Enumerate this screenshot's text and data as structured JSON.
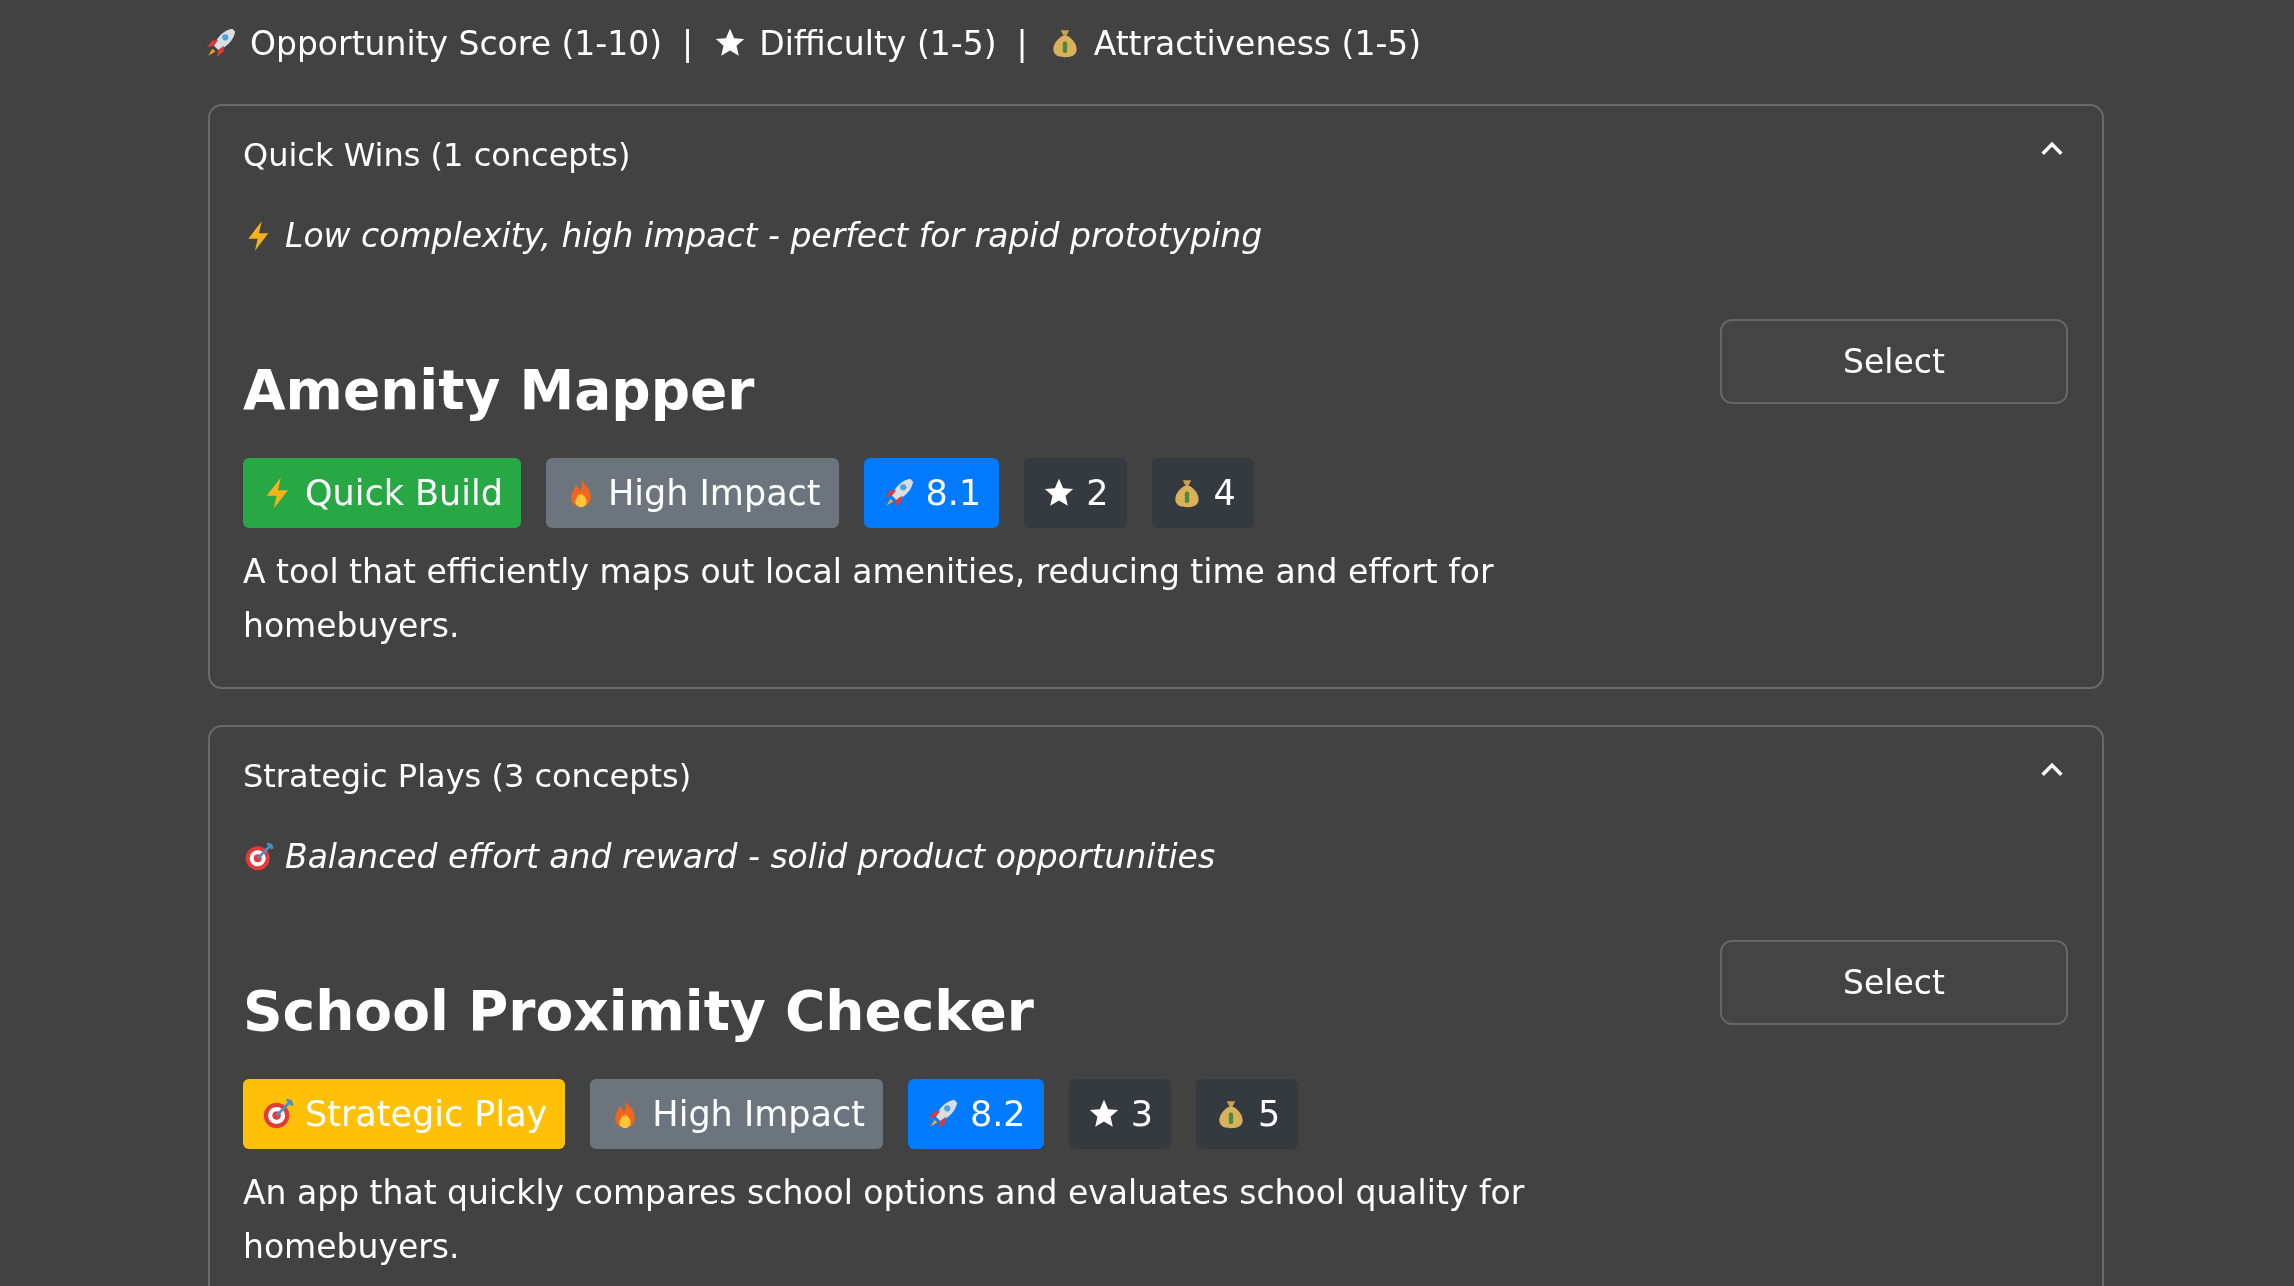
{
  "legend": [
    {
      "kind": "score",
      "label": "Opportunity Score (1-10)"
    },
    {
      "kind": "difficulty",
      "label": "Difficulty (1-5)"
    },
    {
      "kind": "attractiveness",
      "label": "Attractiveness (1-5)"
    }
  ],
  "legend_separator": "|",
  "sections": [
    {
      "title": "Quick Wins (1 concepts)",
      "expanded": true,
      "tagline": {
        "kind": "quick",
        "text": "Low complexity, high impact - perfect for rapid prototyping"
      },
      "concepts": [
        {
          "name": "Amenity Mapper",
          "button": "Select",
          "badges": [
            {
              "kind": "quick",
              "label": "Quick Build",
              "color": "#28a745"
            },
            {
              "kind": "impact",
              "label": "High Impact",
              "color": "#6c757d"
            },
            {
              "kind": "score",
              "label": "8.1",
              "color": "#007bff"
            },
            {
              "kind": "difficulty",
              "label": "2",
              "color": "#343a40"
            },
            {
              "kind": "attractiveness",
              "label": "4",
              "color": "#343a40"
            }
          ],
          "description": "A tool that efficiently maps out local amenities, reducing time and effort for homebuyers."
        }
      ]
    },
    {
      "title": "Strategic Plays (3 concepts)",
      "expanded": true,
      "tagline": {
        "kind": "strategic",
        "text": "Balanced effort and reward - solid product opportunities"
      },
      "concepts": [
        {
          "name": "School Proximity Checker",
          "button": "Select",
          "badges": [
            {
              "kind": "strategic",
              "label": "Strategic Play",
              "color": "#ffc107"
            },
            {
              "kind": "impact",
              "label": "High Impact",
              "color": "#6c757d"
            },
            {
              "kind": "score",
              "label": "8.2",
              "color": "#007bff"
            },
            {
              "kind": "difficulty",
              "label": "3",
              "color": "#343a40"
            },
            {
              "kind": "attractiveness",
              "label": "5",
              "color": "#343a40"
            }
          ],
          "description": "An app that quickly compares school options and evaluates school quality for homebuyers."
        }
      ]
    }
  ]
}
